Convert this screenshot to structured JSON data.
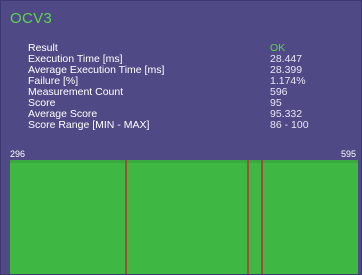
{
  "tool": {
    "name": "OCV3"
  },
  "results": [
    {
      "label": "Result",
      "value": "OK"
    },
    {
      "label": "Execution Time [ms]",
      "value": "28.447"
    },
    {
      "label": "Average Execution Time [ms]",
      "value": "28.399"
    },
    {
      "label": "Failure [%]",
      "value": "1.174%"
    },
    {
      "label": "Measurement Count",
      "value": "596"
    },
    {
      "label": "Score",
      "value": "95"
    },
    {
      "label": "Average Score",
      "value": "95.332"
    },
    {
      "label": "Score Range [MIN - MAX]",
      "value": "86 - 100"
    }
  ],
  "graph": {
    "range_min": "296",
    "range_max": "595",
    "colors": {
      "fill": "#3fb843",
      "marker": "#a34a3a"
    },
    "failure_marks_fraction": [
      0.33,
      0.68,
      0.72
    ]
  },
  "colors": {
    "panel_background": "#4f4a86",
    "accent_green": "#5ed34f"
  }
}
